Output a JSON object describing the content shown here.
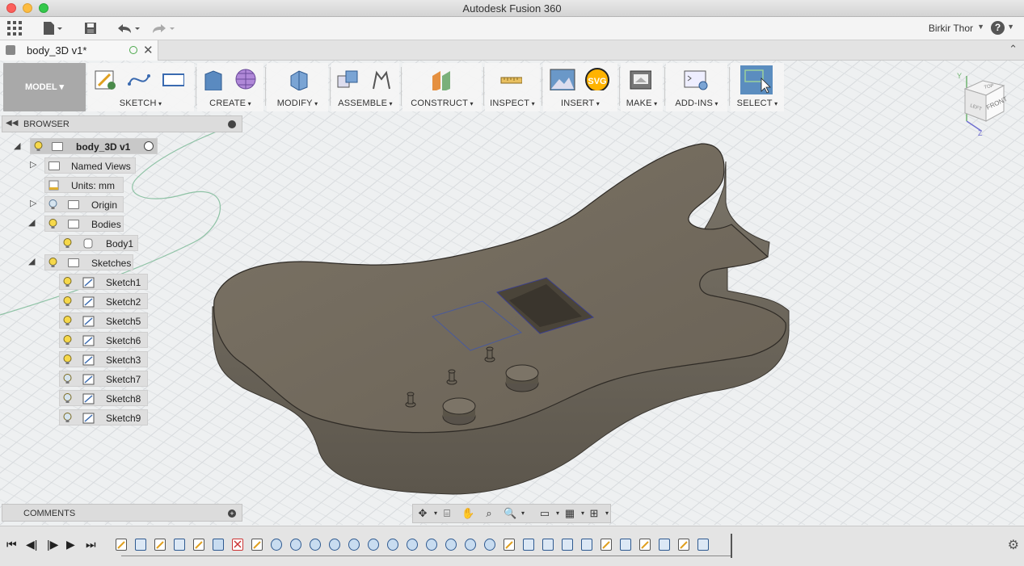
{
  "window": {
    "title": "Autodesk Fusion 360"
  },
  "appbar": {
    "user_name": "Birkir Thor",
    "help_label": "?"
  },
  "document": {
    "tab_title": "body_3D v1*"
  },
  "toolbar": {
    "workspace": "MODEL",
    "groups": [
      "SKETCH",
      "CREATE",
      "MODIFY",
      "ASSEMBLE",
      "CONSTRUCT",
      "INSPECT",
      "INSERT",
      "MAKE",
      "ADD-INS",
      "SELECT"
    ],
    "svg_badge": "SVG"
  },
  "browser": {
    "title": "BROWSER",
    "root": "body_3D v1",
    "named_views": "Named Views",
    "units": "Units: mm",
    "origin": "Origin",
    "bodies": "Bodies",
    "body1": "Body1",
    "sketches": "Sketches",
    "sketch_items": [
      "Sketch1",
      "Sketch2",
      "Sketch5",
      "Sketch6",
      "Sketch3",
      "Sketch7",
      "Sketch8",
      "Sketch9"
    ]
  },
  "comments": {
    "title": "COMMENTS"
  },
  "viewcube": {
    "top": "TOP",
    "front": "FRONT",
    "left": "LEFT",
    "axis_y": "Y",
    "axis_z": "Z"
  },
  "colors": {
    "accent_select": "#5b8dbf",
    "body_fill": "#6e665a",
    "grid": "#d9dde0"
  }
}
